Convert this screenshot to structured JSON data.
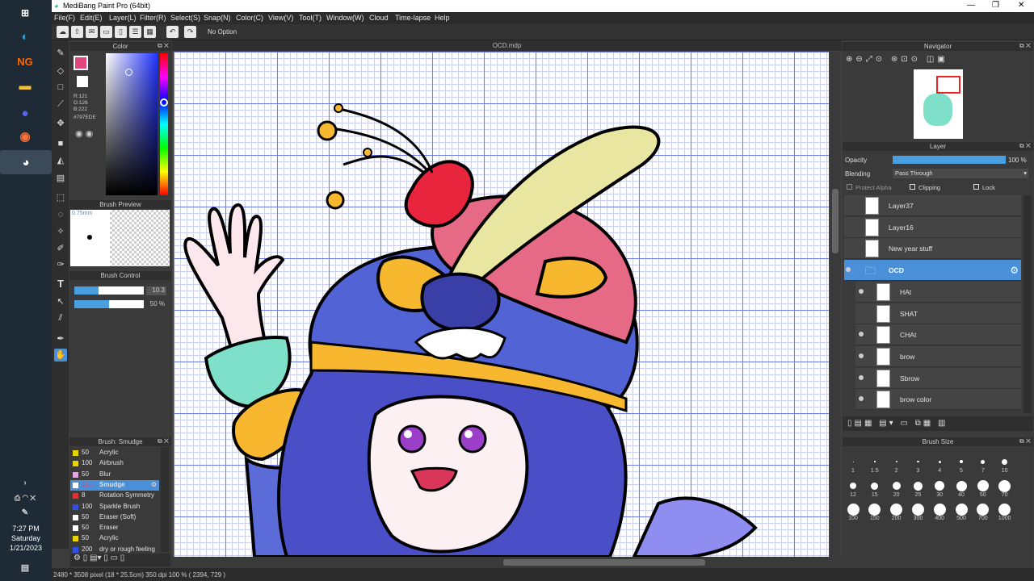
{
  "app": {
    "title": "MediBang Paint Pro (64bit)",
    "document_tab": "OCD.mdp"
  },
  "menu": [
    "File(F)",
    "Edit(E)",
    "Layer(L)",
    "Filter(R)",
    "Select(S)",
    "Snap(N)",
    "Color(C)",
    "View(V)",
    "Tool(T)",
    "Window(W)",
    "Cloud",
    "Time-lapse",
    "Help"
  ],
  "toolbar": {
    "option_text": "No Option"
  },
  "color_panel": {
    "title": "Color",
    "r": "R:121",
    "g": "G:126",
    "b": "B:222",
    "hex": "#797EDE",
    "primary_color": "#e0457d",
    "secondary_color": "#ffffff"
  },
  "brush_preview": {
    "title": "Brush Preview",
    "size_label": "0.75mm"
  },
  "brush_control": {
    "title": "Brush Control",
    "size_value": "10.3",
    "opacity_value": "50 %",
    "size_fraction": 0.35,
    "opacity_fraction": 0.5
  },
  "brush_list": {
    "title": "Brush: Smudge",
    "items": [
      {
        "num": "50",
        "name": "Acrylic",
        "color": "#e8d400"
      },
      {
        "num": "100",
        "name": "Airbrush",
        "color": "#e8d400"
      },
      {
        "num": "50",
        "name": "Blur",
        "color": "#f0a0e0"
      },
      {
        "num": "10.3",
        "name": "Smudge",
        "color": "#ffffff",
        "selected": true
      },
      {
        "num": "8",
        "name": "Rotation Symmetry",
        "color": "#e03030"
      },
      {
        "num": "100",
        "name": "Sparkle Brush",
        "color": "#3050e0"
      },
      {
        "num": "50",
        "name": "Eraser (Soft)",
        "color": "#ffffff"
      },
      {
        "num": "50",
        "name": "Eraser",
        "color": "#ffffff"
      },
      {
        "num": "50",
        "name": "Acrylic",
        "color": "#e8d400"
      },
      {
        "num": "200",
        "name": "dry or rough feeling",
        "color": "#3050e0"
      }
    ]
  },
  "navigator": {
    "title": "Navigator"
  },
  "layer_panel": {
    "title": "Layer",
    "opacity_label": "Opacity",
    "opacity_value": "100 %",
    "blending_label": "Blending",
    "blending_value": "Pass Through",
    "protect_alpha": "Protect Alpha",
    "clipping": "Clipping",
    "lock": "Lock",
    "layers": [
      {
        "name": "Layer37",
        "visible": false,
        "indent": false
      },
      {
        "name": "Layer16",
        "visible": false,
        "indent": false
      },
      {
        "name": "New year stuff",
        "visible": false,
        "indent": false
      },
      {
        "name": "OCD",
        "visible": true,
        "indent": false,
        "folder": true,
        "selected": true
      },
      {
        "name": "HAt",
        "visible": true,
        "indent": true
      },
      {
        "name": "SHAT",
        "visible": false,
        "indent": true
      },
      {
        "name": "CHAt",
        "visible": true,
        "indent": true
      },
      {
        "name": "brow",
        "visible": true,
        "indent": true
      },
      {
        "name": "Sbrow",
        "visible": true,
        "indent": true
      },
      {
        "name": "brow color",
        "visible": true,
        "indent": true
      }
    ]
  },
  "brush_size": {
    "title": "Brush Size",
    "row1": [
      "1",
      "1.5",
      "2",
      "3",
      "4",
      "5",
      "7",
      "10"
    ],
    "row2": [
      "12",
      "15",
      "20",
      "25",
      "30",
      "40",
      "50",
      "70"
    ],
    "row3": [
      "100",
      "150",
      "200",
      "300",
      "400",
      "500",
      "700",
      "1000"
    ]
  },
  "status": {
    "text": "2480 * 3508 pixel  (18 * 25.5cm)  350 dpi  100 %  ( 2394, 729 )"
  },
  "taskbar": {
    "time": "7:27 PM",
    "day": "Saturday",
    "date": "1/21/2023"
  }
}
